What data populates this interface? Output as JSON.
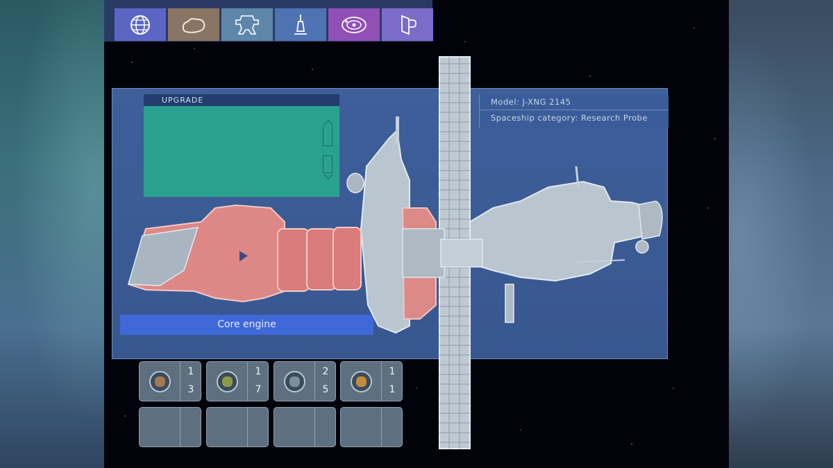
{
  "tabs": [
    {
      "name": "globe",
      "color": "#5b66c4"
    },
    {
      "name": "asteroid",
      "color": "#8a7464"
    },
    {
      "name": "station",
      "color": "#5e86a8"
    },
    {
      "name": "probe",
      "color": "#4f72b2"
    },
    {
      "name": "orbit",
      "color": "#9050b8"
    },
    {
      "name": "gate",
      "color": "#7a6cc8"
    }
  ],
  "upgrade": {
    "title": "UPGRADE"
  },
  "info": {
    "model": "Model: J-XNG 2145",
    "category": "Spaceship category: Research Probe"
  },
  "selected_part": "Core engine",
  "inventory": [
    {
      "top": "1",
      "bottom": "3",
      "color": "#a27a52"
    },
    {
      "top": "1",
      "bottom": "7",
      "color": "#8c9a4a"
    },
    {
      "top": "2",
      "bottom": "5",
      "color": "#7d8f9c"
    },
    {
      "top": "1",
      "bottom": "1",
      "color": "#c58a3c"
    }
  ]
}
